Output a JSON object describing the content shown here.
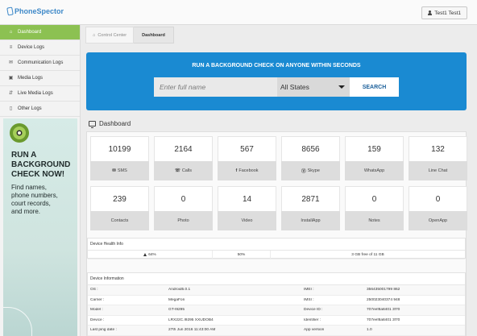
{
  "app": {
    "name": "PhoneSpector"
  },
  "user": {
    "label": "Test1 Test1"
  },
  "sidebar": {
    "items": [
      {
        "label": "Dashboard",
        "icon": "home-icon",
        "active": true
      },
      {
        "label": "Device Logs",
        "icon": "list-icon"
      },
      {
        "label": "Communication Logs",
        "icon": "envelope-icon"
      },
      {
        "label": "Media Logs",
        "icon": "photo-icon"
      },
      {
        "label": "Live Media Logs",
        "icon": "sort-icon"
      },
      {
        "label": "Other Logs",
        "icon": "file-icon"
      }
    ]
  },
  "ad": {
    "headline": [
      "RUN A",
      "BACKGROUND",
      "CHECK NOW!"
    ],
    "sub": [
      "Find names,",
      "phone numbers,",
      "court records,",
      "and more."
    ]
  },
  "breadcrumb": {
    "root": "Control Center",
    "current": "Dashboard"
  },
  "search": {
    "title": "RUN A BACKGROUND CHECK ON ANYONE WITHIN SECONDS",
    "placeholder": "Enter full name",
    "state": "All States",
    "button": "SEARCH"
  },
  "dashboard": {
    "title": "Dashboard",
    "stats": [
      {
        "value": "10199",
        "label": "SMS",
        "icon": "envelope-icon"
      },
      {
        "value": "2164",
        "label": "Calls",
        "icon": "phone-icon"
      },
      {
        "value": "567",
        "label": "Facebook",
        "icon": "facebook-icon"
      },
      {
        "value": "8656",
        "label": "Skype",
        "icon": "skype-icon"
      },
      {
        "value": "159",
        "label": "WhatsApp",
        "icon": ""
      },
      {
        "value": "132",
        "label": "Line Chat",
        "icon": ""
      },
      {
        "value": "239",
        "label": "Contacts",
        "icon": ""
      },
      {
        "value": "0",
        "label": "Photo",
        "icon": ""
      },
      {
        "value": "14",
        "label": "Video",
        "icon": ""
      },
      {
        "value": "2871",
        "label": "InstallApp",
        "icon": ""
      },
      {
        "value": "0",
        "label": "Notes",
        "icon": ""
      },
      {
        "value": "0",
        "label": "OpenApp",
        "icon": ""
      }
    ],
    "health": {
      "title": "Device Health Info",
      "battery": "64%",
      "signal": "50%",
      "storage": "3 GB free of 11 GB"
    },
    "info": {
      "title": "Device Information",
      "rows": [
        {
          "k1": "OS :",
          "v1": "Android5.0.1",
          "k2": "IMEI :",
          "v2": "356435001799 862"
        },
        {
          "k1": "Carrier :",
          "v1": "MegaFon",
          "k2": "IMSI :",
          "v2": "250023040374 948"
        },
        {
          "k1": "Model :",
          "v1": "GT-I9295",
          "k2": "Device ID :",
          "v2": "707eef8a8401 3f70"
        },
        {
          "k1": "Device :",
          "v1": "LRX22C.I9295 XXUDOB4",
          "k2": "Identifier :",
          "v2": "707eef8a8401 3f70"
        },
        {
          "k1": "Last ping date :",
          "v1": "27th Jun 2016 11:43:00 AM",
          "k2": "App version",
          "v2": "1.0"
        }
      ]
    }
  }
}
